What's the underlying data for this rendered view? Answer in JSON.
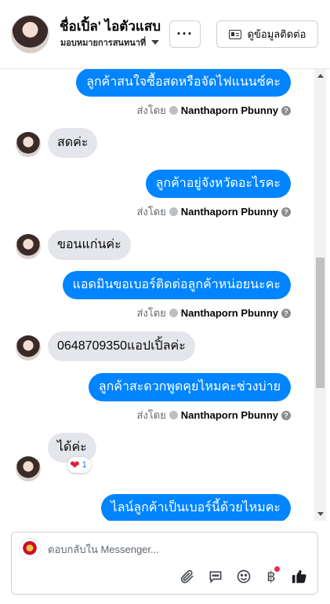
{
  "header": {
    "contact_name": "ชื่อเปิ้ล' ไอตัวแสบ",
    "assignment": "มอบหมายการสนทนาที่",
    "more_label": "···",
    "contact_info_label": "ดูข้อมูลติดต่อ"
  },
  "messages": [
    {
      "direction": "out",
      "text": "ลูกค้าสนใจซื้อสดหรือจัดไฟแนนซ์คะ",
      "sent_by_prefix": "ส่งโดย",
      "sent_by_name": "Nanthaporn Pbunny"
    },
    {
      "direction": "in",
      "text": "สดค่ะ"
    },
    {
      "direction": "out",
      "text": "ลูกค้าอยู่จังหวัดอะไรคะ",
      "sent_by_prefix": "ส่งโดย",
      "sent_by_name": "Nanthaporn Pbunny"
    },
    {
      "direction": "in",
      "text": "ขอนแก่นค่ะ"
    },
    {
      "direction": "out",
      "text": "แอดมินขอเบอร์ติดต่อลูกค้าหน่อยนะคะ",
      "sent_by_prefix": "ส่งโดย",
      "sent_by_name": "Nanthaporn Pbunny"
    },
    {
      "direction": "in",
      "text": "0648709350แอปเปิ้ลค่ะ"
    },
    {
      "direction": "out",
      "text": "ลูกค้าสะดวกพูดคุยไหมคะช่วงบ่าย",
      "sent_by_prefix": "ส่งโดย",
      "sent_by_name": "Nanthaporn Pbunny"
    },
    {
      "direction": "in",
      "text": "ได้ค่ะ",
      "reaction": "❤",
      "reaction_count": "1"
    },
    {
      "direction": "out",
      "text": "ไลน์ลูกค้าเป็นเบอร์นี้ด้วยไหมคะ"
    }
  ],
  "composer": {
    "placeholder": "ตอบกลับใน Messenger...",
    "tools": [
      "paperclip-icon",
      "comment-icon",
      "smiley-icon",
      "baht-icon",
      "thumbs-up-icon"
    ],
    "baht_glyph": "฿"
  },
  "colors": {
    "outgoing_bubble": "#0084ff",
    "incoming_bubble": "#e4e6eb",
    "heart": "#e41e3f",
    "notification_dot": "#f02849"
  }
}
